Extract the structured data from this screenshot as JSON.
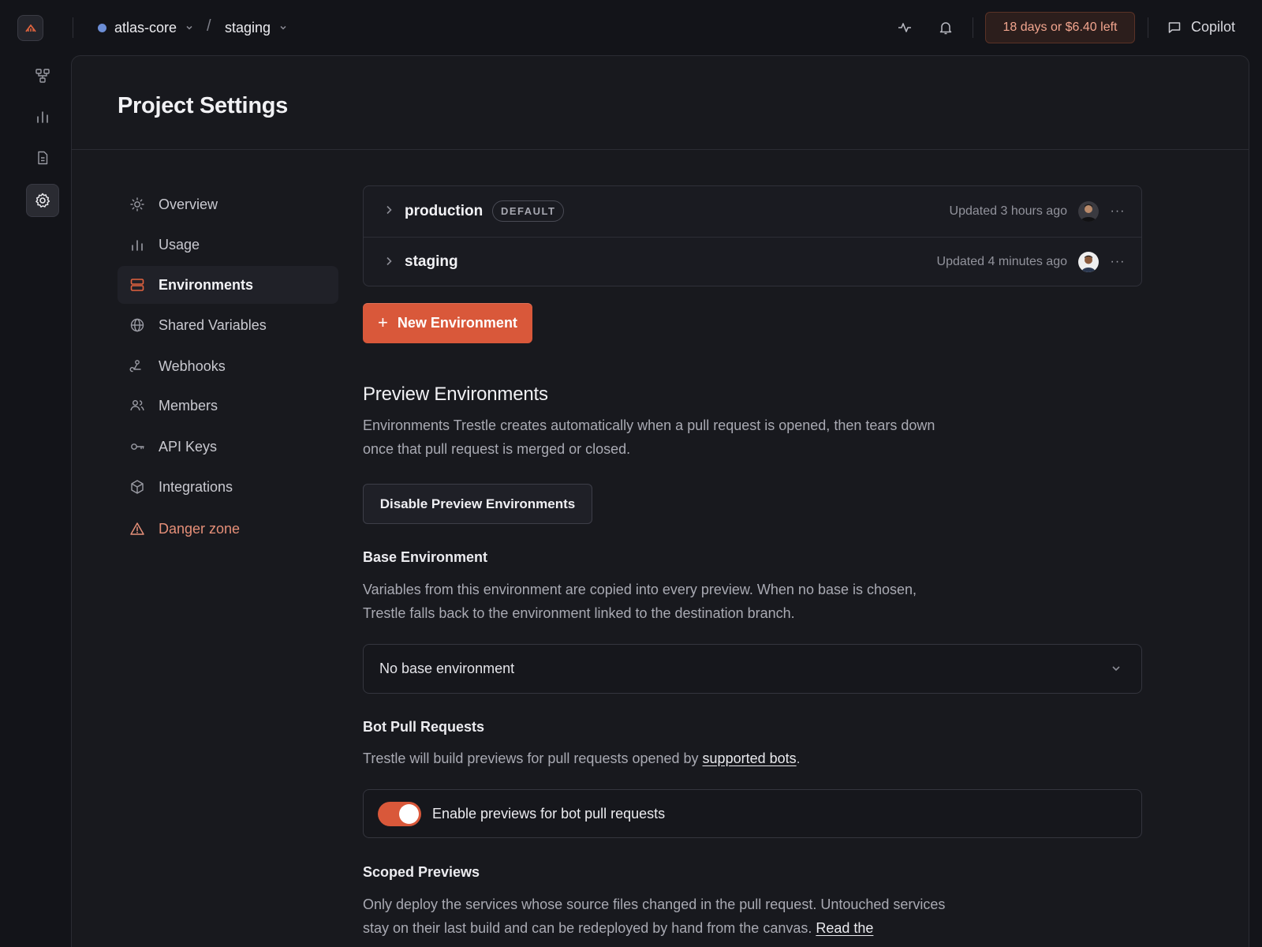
{
  "header": {
    "project": "atlas-core",
    "environment": "staging",
    "trial": "18 days or $6.40 left",
    "copilot": "Copilot"
  },
  "page": {
    "title": "Project Settings"
  },
  "nav": {
    "items": [
      {
        "label": "Overview",
        "icon": "sun-icon"
      },
      {
        "label": "Usage",
        "icon": "bar-chart-icon"
      },
      {
        "label": "Environments",
        "icon": "server-icon",
        "active": true
      },
      {
        "label": "Shared Variables",
        "icon": "globe-icon"
      },
      {
        "label": "Webhooks",
        "icon": "webhook-icon"
      },
      {
        "label": "Members",
        "icon": "users-icon"
      },
      {
        "label": "API Keys",
        "icon": "key-icon"
      },
      {
        "label": "Integrations",
        "icon": "cube-icon"
      },
      {
        "label": "Danger zone",
        "icon": "warning-icon",
        "danger": true
      }
    ]
  },
  "environments": [
    {
      "name": "production",
      "badge": "DEFAULT",
      "updated": "Updated 3 hours ago"
    },
    {
      "name": "staging",
      "updated": "Updated 4 minutes ago"
    }
  ],
  "new_env_label": "New Environment",
  "preview": {
    "title": "Preview Environments",
    "description": "Environments Trestle creates automatically when a pull request is opened, then tears down once that pull request is merged or closed.",
    "disable_label": "Disable Preview Environments"
  },
  "base_env": {
    "title": "Base Environment",
    "description": "Variables from this environment are copied into every preview. When no base is chosen, Trestle falls back to the environment linked to the destination branch.",
    "selected": "No base environment"
  },
  "bot_pr": {
    "title": "Bot Pull Requests",
    "description_prefix": "Trestle will build previews for pull requests opened by ",
    "link": "supported bots",
    "description_suffix": ".",
    "toggle_label": "Enable previews for bot pull requests",
    "enabled": true
  },
  "scoped": {
    "title": "Scoped Previews",
    "description": "Only deploy the services whose source files changed in the pull request. Untouched services stay on their last build and can be redeployed by hand from the canvas. ",
    "link": "Read the"
  },
  "colors": {
    "accent": "#d9583a",
    "background": "#131419",
    "panel": "#18191e"
  }
}
